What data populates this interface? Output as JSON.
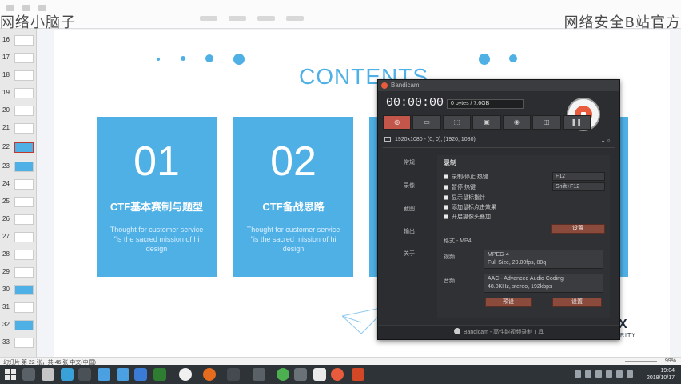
{
  "app": {
    "title": "网络安全B站官方",
    "watermark_left": "网络小脑子",
    "watermark_right": "网络安全B站官方"
  },
  "thumbnails": [
    {
      "num": "16"
    },
    {
      "num": "17"
    },
    {
      "num": "18"
    },
    {
      "num": "19"
    },
    {
      "num": "20"
    },
    {
      "num": "21"
    },
    {
      "num": "22"
    },
    {
      "num": "23"
    },
    {
      "num": "24"
    },
    {
      "num": "25"
    },
    {
      "num": "26"
    },
    {
      "num": "27"
    },
    {
      "num": "28"
    },
    {
      "num": "29"
    },
    {
      "num": "30"
    },
    {
      "num": "31"
    },
    {
      "num": "32"
    },
    {
      "num": "33"
    }
  ],
  "slide": {
    "title": "CONTENTS",
    "cards": [
      {
        "num": "01",
        "title": "CTF基本赛制与题型",
        "desc": "Thought for customer service \"is the sacred mission of hi design"
      },
      {
        "num": "02",
        "title": "CTF备战思路",
        "desc": "Thought for customer service \"is the sacred mission of hi design"
      }
    ],
    "logo_text": "X",
    "logo_sub": "RITY"
  },
  "bandicam": {
    "title": "Bandicam",
    "timer": "00:00:00",
    "size": "0 bytes / 7.6GB",
    "resolution": "1920x1080 - (0, 0), (1920, 1080)",
    "side_menu": [
      "常规",
      "录像",
      "截图",
      "输出",
      "关于"
    ],
    "section_record": "录制",
    "checks": [
      {
        "label": "录制/停止 热键",
        "key": "F12"
      },
      {
        "label": "暂停 热键",
        "key": "Shift+F12"
      },
      {
        "label": "显示鼠标指针"
      },
      {
        "label": "添加鼠标点击效果"
      },
      {
        "label": "开启摄像头叠加"
      }
    ],
    "settings_btn": "设置",
    "format_label": "格式 - MP4",
    "video_label": "视频",
    "video_codec": "MPEG-4",
    "video_detail": "Full Size, 20.00fps, 80q",
    "audio_label": "音频",
    "audio_codec": "AAC - Advanced Audio Coding",
    "audio_detail": "48.0KHz, stereo, 192kbps",
    "preset_btn": "预设",
    "setup_btn": "设置",
    "footer": "Bandicam - 高性能视频录制工具"
  },
  "status": {
    "left": "幻灯片 第 22 张，共 46 张    中文(中国)",
    "right": "99%"
  },
  "taskbar": {
    "time": "19:04",
    "date": "2018/10/17"
  }
}
